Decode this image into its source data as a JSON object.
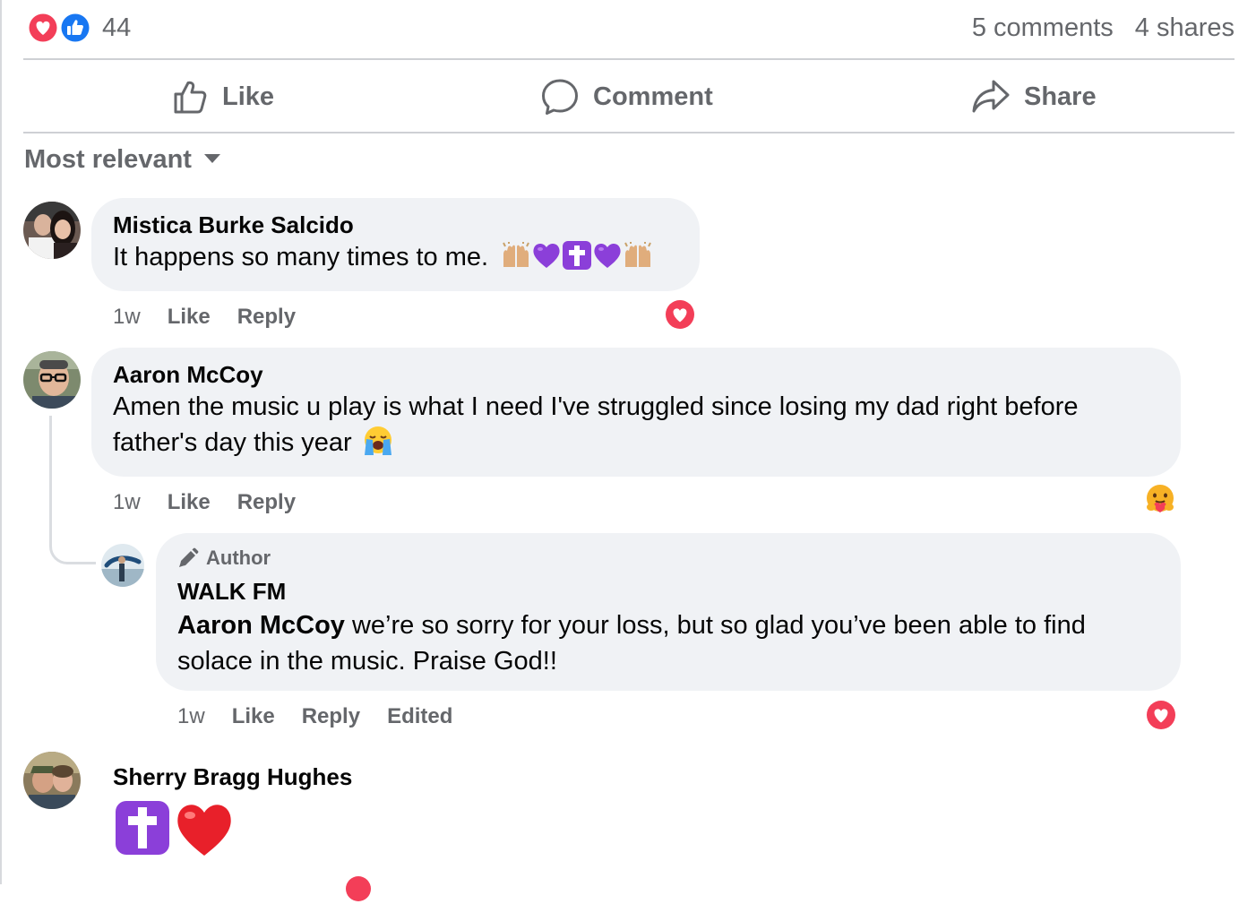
{
  "summary": {
    "reaction_count": "44",
    "reaction_types": [
      "love",
      "like"
    ],
    "comments_count": "5 comments",
    "shares_count": "4 shares"
  },
  "actions": {
    "like": "Like",
    "comment": "Comment",
    "share": "Share"
  },
  "sort": {
    "label": "Most relevant"
  },
  "comments": [
    {
      "name": "Mistica Burke Salcido",
      "text": "It happens so many times to me.",
      "emoji": [
        "raising-hands",
        "purple-heart",
        "latin-cross",
        "purple-heart",
        "raising-hands"
      ],
      "time": "1w",
      "like": "Like",
      "reply": "Reply",
      "reaction": "love"
    },
    {
      "name": "Aaron McCoy",
      "text": "Amen the music u play is what I need I've struggled since losing my dad right before father's day this year",
      "emoji": [
        "loudly-crying-face"
      ],
      "time": "1w",
      "like": "Like",
      "reply": "Reply",
      "reaction": "care",
      "replies": [
        {
          "badge": "Author",
          "name": "WALK FM",
          "mention": "Aaron McCoy",
          "text": " we’re so sorry for your loss, but so glad you’ve been able to find solace in the music. Praise God!!",
          "time": "1w",
          "like": "Like",
          "reply": "Reply",
          "edited": "Edited",
          "reaction": "love"
        }
      ]
    },
    {
      "name": "Sherry Bragg Hughes",
      "emoji": [
        "latin-cross",
        "red-heart"
      ]
    }
  ],
  "colors": {
    "love": "#f33e58",
    "like_blue": "#1877f2",
    "muted_text": "#65676b",
    "bubble": "#f0f2f5",
    "divider": "#ced0d4"
  }
}
